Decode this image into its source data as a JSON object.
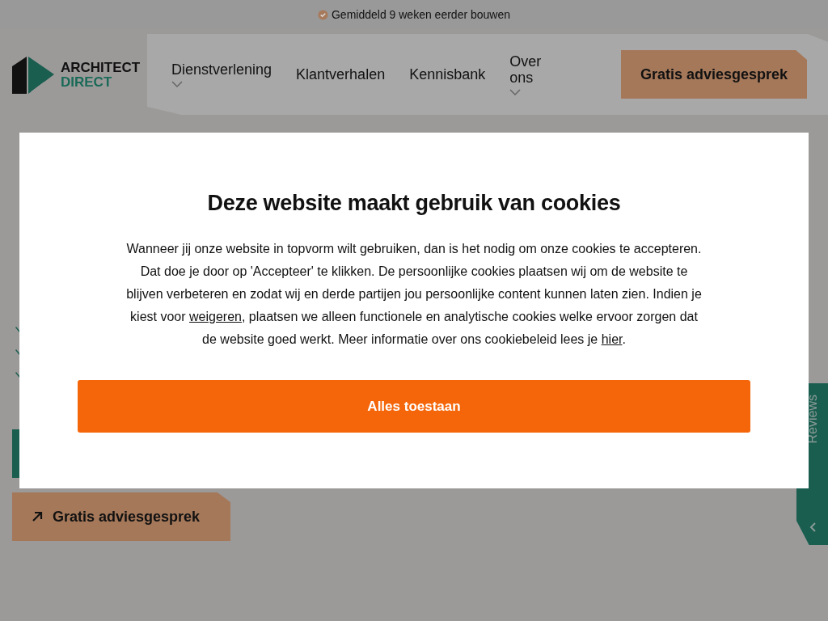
{
  "top_bar": {
    "text": "Gemiddeld 9 weken eerder bouwen"
  },
  "logo": {
    "line_1": "ARCHITECT",
    "line_2": "DIRECT"
  },
  "nav": {
    "items": [
      {
        "label": "Dienstverlening",
        "dropdown": true
      },
      {
        "label": "Klantverhalen",
        "dropdown": false
      },
      {
        "label": "Kennisbank",
        "dropdown": false
      },
      {
        "label": "Over ons",
        "dropdown": true
      }
    ],
    "cta": "Gratis adviesgesprek"
  },
  "hero": {
    "cta": "Gratis adviesgesprek"
  },
  "reviews_tab": {
    "label": "Reviews"
  },
  "cookie_dialog": {
    "title": "Deze website maakt gebruik van cookies",
    "body": "Wanneer jij onze website in topvorm wilt gebruiken, dan is het nodig om onze cookies te accepteren. Dat doe je door op 'Accepteer' te klikken. De persoonlijke cookies plaatsen wij om de website te blijven verbeteren en zodat wij en derde partijen jou persoonlijke content kunnen laten zien. Indien je kiest voor ",
    "link_1": "weigeren",
    "body_2": ", plaatsen we alleen functionele en analytische cookies welke ervoor zorgen dat de website goed werkt. Meer informatie over ons cookiebeleid lees je ",
    "link_2": "hier",
    "body_3": ".",
    "button": "Alles toestaan"
  }
}
